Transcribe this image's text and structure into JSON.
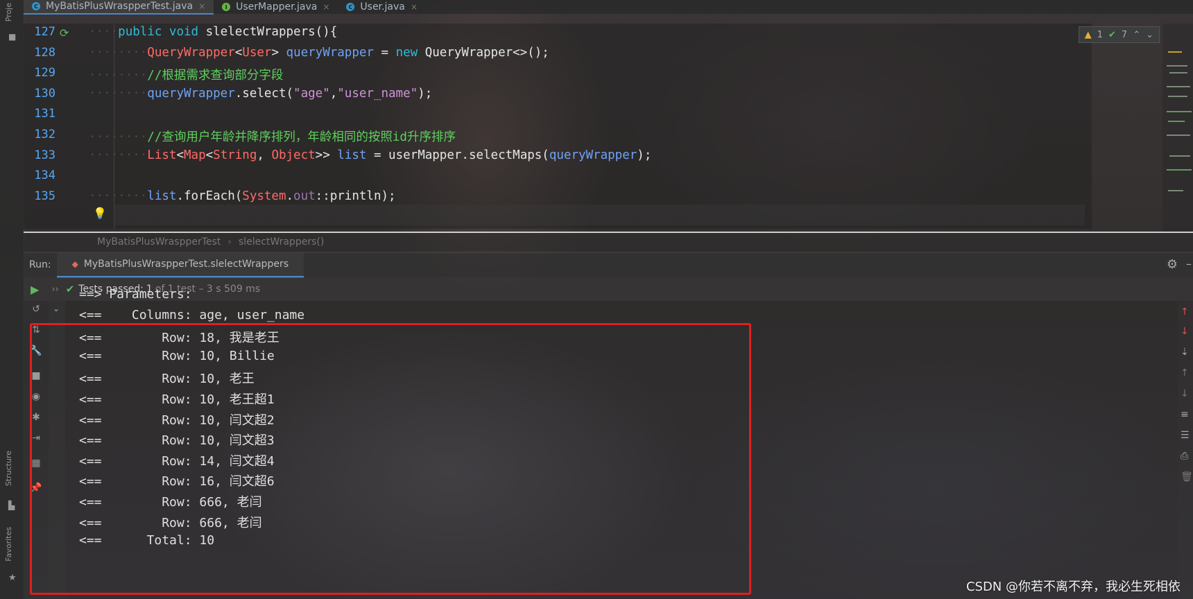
{
  "tabs": [
    {
      "label": "MyBatisPlusWraspperTest.java",
      "icon": "c",
      "color": "#3592c4"
    },
    {
      "label": "UserMapper.java",
      "icon": "i",
      "color": "#62b543"
    },
    {
      "label": "User.java",
      "icon": "c",
      "color": "#3592c4"
    }
  ],
  "sidebar": {
    "project": "Proje",
    "structure": "Structure",
    "favorites": "Favorites"
  },
  "editor": {
    "lines": [
      {
        "num": "127",
        "dots": "····",
        "parts": [
          [
            "kw2",
            "public "
          ],
          [
            "kw2",
            "void "
          ],
          [
            "plain",
            "slelectWrappers(){"
          ]
        ]
      },
      {
        "num": "128",
        "dots": "········",
        "parts": [
          [
            "typ",
            "QueryWrapper"
          ],
          [
            "plain",
            "<"
          ],
          [
            "typ",
            "User"
          ],
          [
            "plain",
            "> "
          ],
          [
            "var",
            "queryWrapper"
          ],
          [
            "plain",
            " = "
          ],
          [
            "kw2",
            "new "
          ],
          [
            "plain",
            "QueryWrapper<>();"
          ]
        ]
      },
      {
        "num": "129",
        "dots": "········",
        "parts": [
          [
            "cmt",
            "//根据需求查询部分字段"
          ]
        ]
      },
      {
        "num": "130",
        "dots": "········",
        "parts": [
          [
            "var",
            "queryWrapper"
          ],
          [
            "plain",
            ".select("
          ],
          [
            "str",
            "\"age\""
          ],
          [
            "plain",
            ","
          ],
          [
            "str",
            "\"user_name\""
          ],
          [
            "plain",
            ");"
          ]
        ]
      },
      {
        "num": "131",
        "dots": "",
        "parts": []
      },
      {
        "num": "132",
        "dots": "········",
        "parts": [
          [
            "cmt",
            "//查询用户年龄并降序排列，年龄相同的按照id升序排序"
          ]
        ]
      },
      {
        "num": "133",
        "dots": "········",
        "parts": [
          [
            "typ",
            "List"
          ],
          [
            "plain",
            "<"
          ],
          [
            "typ",
            "Map"
          ],
          [
            "plain",
            "<"
          ],
          [
            "typ",
            "String"
          ],
          [
            "plain",
            ", "
          ],
          [
            "typ",
            "Object"
          ],
          [
            "plain",
            ">> "
          ],
          [
            "var",
            "list"
          ],
          [
            "plain",
            " = "
          ],
          [
            "plain",
            "userMapper.selectMaps("
          ],
          [
            "var",
            "queryWrapper"
          ],
          [
            "plain",
            ");"
          ]
        ]
      },
      {
        "num": "134",
        "dots": "",
        "parts": []
      },
      {
        "num": "135",
        "dots": "········",
        "parts": [
          [
            "var",
            "list"
          ],
          [
            "plain",
            ".forEach("
          ],
          [
            "typ",
            "System"
          ],
          [
            "plain",
            "."
          ],
          [
            "mag",
            "out"
          ],
          [
            "plain",
            "::println);"
          ]
        ]
      }
    ],
    "inspection": {
      "warnings": "1",
      "checks": "7"
    }
  },
  "breadcrumbs": [
    "MyBatisPlusWraspperTest",
    "slelectWrappers()"
  ],
  "run": {
    "label": "Run:",
    "tab": "MyBatisPlusWraspperTest.slelectWrappers",
    "status_passed": "Tests passed:",
    "status_count": "1",
    "status_rest": "of 1 test – 3 s 509 ms"
  },
  "console": [
    "==> Parameters: ",
    "<==    Columns: age, user_name",
    "<==        Row: 18, 我是老王",
    "<==        Row: 10, Billie",
    "<==        Row: 10, 老王",
    "<==        Row: 10, 老王超1",
    "<==        Row: 10, 闫文超2",
    "<==        Row: 10, 闫文超3",
    "<==        Row: 14, 闫文超4",
    "<==        Row: 16, 闫文超6",
    "<==        Row: 666, 老闫",
    "<==        Row: 666, 老闫",
    "<==      Total: 10"
  ],
  "watermark": "CSDN @你若不离不弃，我必生死相依"
}
